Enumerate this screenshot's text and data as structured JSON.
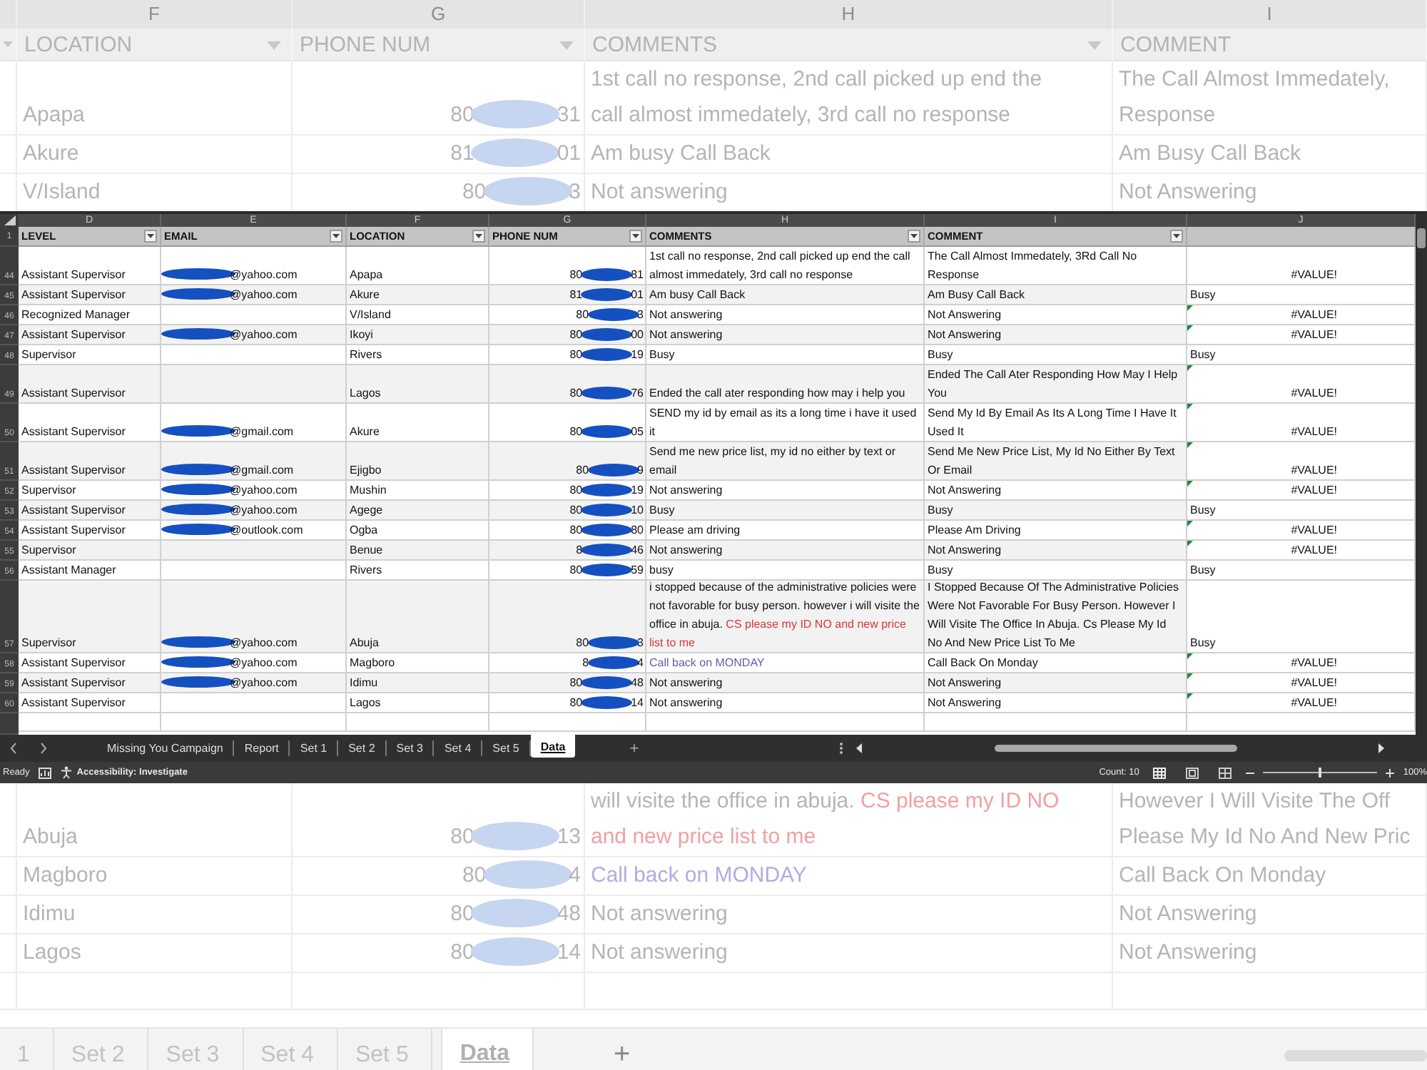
{
  "background_top": {
    "column_letters": [
      "F",
      "G",
      "H",
      "I"
    ],
    "headers": [
      "LOCATION",
      "PHONE NUM",
      "COMMENTS",
      "COMMENT"
    ],
    "rows": [
      {
        "location": "Apapa",
        "phone_start": "80",
        "phone_end": "31",
        "comments": [
          [
            {
              "text": "1st call no response, 2nd call picked up end the"
            }
          ],
          [
            {
              "text": "call almost immedately, 3rd call no response"
            }
          ]
        ],
        "comment": [
          "The Call Almost Immedately,",
          "Response"
        ]
      },
      {
        "location": "Akure",
        "phone_start": "81",
        "phone_end": "01",
        "comments": [
          [
            {
              "text": "Am busy Call Back"
            }
          ]
        ],
        "comment": [
          "Am Busy Call Back"
        ]
      },
      {
        "location": "V/Island",
        "phone_start": "80",
        "phone_end": "3",
        "comments": [
          [
            {
              "text": "Not answering"
            }
          ]
        ],
        "comment": [
          "Not Answering"
        ]
      }
    ]
  },
  "sheet": {
    "column_letters": [
      "D",
      "E",
      "F",
      "G",
      "H",
      "I",
      "J"
    ],
    "header_row_number": "1",
    "headers": [
      "LEVEL",
      "EMAIL",
      "LOCATION",
      "PHONE NUM",
      "COMMENTS",
      "COMMENT"
    ],
    "rows": [
      {
        "num": "44",
        "level": "Assistant Supervisor",
        "email": "@yahoo.com",
        "location": "Apapa",
        "phone_start": "80",
        "phone_end": "81",
        "comments": [
          {
            "text": "1st call no response, 2nd call picked up end the call almost immedately, 3rd call no response"
          }
        ],
        "comment": "The Call Almost Immedately, 3Rd Call No Response",
        "col_j": {
          "text": "#VALUE!",
          "kind": "error",
          "flag": false
        }
      },
      {
        "num": "45",
        "level": "Assistant Supervisor",
        "email": "@yahoo.com",
        "location": "Akure",
        "phone_start": "81",
        "phone_end": "01",
        "comments": [
          {
            "text": "Am busy Call Back"
          }
        ],
        "comment": "Am Busy Call Back",
        "col_j": {
          "text": "Busy",
          "kind": "text",
          "flag": false
        }
      },
      {
        "num": "46",
        "level": "Recognized Manager",
        "location": "V/Island",
        "phone_start": "80",
        "phone_end": "3",
        "comments": [
          {
            "text": "Not answering"
          }
        ],
        "comment": "Not Answering",
        "col_j": {
          "text": "#VALUE!",
          "kind": "error",
          "flag": true
        }
      },
      {
        "num": "47",
        "level": "Assistant Supervisor",
        "email": "@yahoo.com",
        "location": "Ikoyi",
        "phone_start": "80",
        "phone_end": "00",
        "comments": [
          {
            "text": "Not answering"
          }
        ],
        "comment": "Not Answering",
        "col_j": {
          "text": "#VALUE!",
          "kind": "error",
          "flag": true
        }
      },
      {
        "num": "48",
        "level": "Supervisor",
        "location": "Rivers",
        "phone_start": "80",
        "phone_end": "19",
        "comments": [
          {
            "text": "Busy"
          }
        ],
        "comment": "Busy",
        "col_j": {
          "text": "Busy",
          "kind": "text",
          "flag": false
        }
      },
      {
        "num": "49",
        "level": "Assistant Supervisor",
        "location": "Lagos",
        "phone_start": "80",
        "phone_end": "76",
        "comments": [
          {
            "text": "Ended the call ater responding how may i help you"
          }
        ],
        "comment": "Ended The Call Ater Responding How May I Help You",
        "col_j": {
          "text": "#VALUE!",
          "kind": "error",
          "flag": true
        }
      },
      {
        "num": "50",
        "level": "Assistant Supervisor",
        "email": "@gmail.com",
        "location": "Akure",
        "phone_start": "80",
        "phone_end": "05",
        "comments": [
          {
            "text": "SEND my id by email as its a long time i have it used it"
          }
        ],
        "comment": "Send My Id By Email As Its A Long Time I Have It Used It",
        "col_j": {
          "text": "#VALUE!",
          "kind": "error",
          "flag": true
        }
      },
      {
        "num": "51",
        "level": "Assistant Supervisor",
        "email": "@gmail.com",
        "location": "Ejigbo",
        "phone_start": "80",
        "phone_end": "9",
        "comments": [
          {
            "text": "Send me new price list, my id no either by text or email"
          }
        ],
        "comment": "Send Me New Price List, My Id No Either By Text Or Email",
        "col_j": {
          "text": "#VALUE!",
          "kind": "error",
          "flag": true
        }
      },
      {
        "num": "52",
        "level": "Supervisor",
        "email": "@yahoo.com",
        "location": "Mushin",
        "phone_start": "80",
        "phone_end": "19",
        "comments": [
          {
            "text": "Not answering"
          }
        ],
        "comment": "Not Answering",
        "col_j": {
          "text": "#VALUE!",
          "kind": "error",
          "flag": true
        }
      },
      {
        "num": "53",
        "level": "Assistant Supervisor",
        "email": "@yahoo.com",
        "location": "Agege",
        "phone_start": "80",
        "phone_end": "10",
        "comments": [
          {
            "text": "Busy"
          }
        ],
        "comment": "Busy",
        "col_j": {
          "text": "Busy",
          "kind": "text",
          "flag": false
        }
      },
      {
        "num": "54",
        "level": "Assistant Supervisor",
        "email": "@outlook.com",
        "location": "Ogba",
        "phone_start": "80",
        "phone_end": "80",
        "comments": [
          {
            "text": "Please am driving"
          }
        ],
        "comment": "Please Am Driving",
        "col_j": {
          "text": "#VALUE!",
          "kind": "error",
          "flag": true
        }
      },
      {
        "num": "55",
        "level": "Supervisor",
        "location": "Benue",
        "phone_start": "8",
        "phone_end": "46",
        "comments": [
          {
            "text": "Not answering"
          }
        ],
        "comment": "Not Answering",
        "col_j": {
          "text": "#VALUE!",
          "kind": "error",
          "flag": true
        }
      },
      {
        "num": "56",
        "level": "Assistant Manager",
        "location": "Rivers",
        "phone_start": "80",
        "phone_end": "59",
        "comments": [
          {
            "text": "busy"
          }
        ],
        "comment": "Busy",
        "col_j": {
          "text": "Busy",
          "kind": "text",
          "flag": false
        }
      },
      {
        "num": "57",
        "level": "Supervisor",
        "email": "@yahoo.com",
        "location": "Abuja",
        "phone_start": "80",
        "phone_end": "3",
        "comments": [
          {
            "text": "i stopped because of the administrative policies were not favorable for busy person. however i will visite the office in abuja. "
          },
          {
            "text": "CS please my ID NO and new price list to me",
            "color": "#d9343a"
          }
        ],
        "comment": "I Stopped Because Of The Administrative Policies Were Not Favorable For Busy Person. However I Will Visite The Office In Abuja. Cs Please My Id No And New Price List To Me",
        "col_j": {
          "text": "Busy",
          "kind": "text",
          "flag": false
        }
      },
      {
        "num": "58",
        "level": "Assistant Supervisor",
        "email": "@yahoo.com",
        "location": "Magboro",
        "phone_start": "8",
        "phone_end": "4",
        "comments": [
          {
            "text": "Call back on MONDAY",
            "color": "#6a5aa8"
          }
        ],
        "comment": "Call Back On Monday",
        "col_j": {
          "text": "#VALUE!",
          "kind": "error",
          "flag": true
        }
      },
      {
        "num": "59",
        "level": "Assistant Supervisor",
        "email": "@yahoo.com",
        "location": "Idimu",
        "phone_start": "80",
        "phone_end": "48",
        "comments": [
          {
            "text": "Not answering"
          }
        ],
        "comment": "Not Answering",
        "col_j": {
          "text": "#VALUE!",
          "kind": "error",
          "flag": true
        }
      },
      {
        "num": "60",
        "level": "Assistant Supervisor",
        "location": "Lagos",
        "phone_start": "80",
        "phone_end": "14",
        "comments": [
          {
            "text": "Not answering"
          }
        ],
        "comment": "Not Answering",
        "col_j": {
          "text": "#VALUE!",
          "kind": "error",
          "flag": true
        }
      }
    ],
    "tabs": [
      {
        "label": "Missing You Campaign",
        "selected": false
      },
      {
        "label": "Report",
        "selected": false
      },
      {
        "label": "Set 1",
        "selected": false
      },
      {
        "label": "Set 2",
        "selected": false
      },
      {
        "label": "Set 3",
        "selected": false
      },
      {
        "label": "Set 4",
        "selected": false
      },
      {
        "label": "Set 5",
        "selected": false
      },
      {
        "label": "Data",
        "selected": true
      }
    ],
    "add_sheet": "+",
    "status_bar": {
      "ready": "Ready",
      "accessibility": "Accessibility: Investigate",
      "count": "Count: 10",
      "zoom_slider": {
        "level": 0.5
      },
      "zoom": "100%"
    }
  },
  "background_bottom": {
    "rows": [
      {
        "location": "Abuja",
        "phone_start": "80",
        "phone_end": "13",
        "comments": [
          [
            {
              "text": "will visite the office in abuja. "
            },
            {
              "text": "CS please my ID NO",
              "color": "#f2a0a3"
            }
          ],
          [
            {
              "text": "and new price list to me",
              "color": "#f2a0a3"
            }
          ]
        ],
        "comment": [
          "However I Will Visite The Off",
          "Please My Id No And New Pric"
        ]
      },
      {
        "location": "Magboro",
        "phone_start": "80",
        "phone_end": "4",
        "comments": [
          [
            {
              "text": "Call back on MONDAY",
              "color": "#b4abe0"
            }
          ]
        ],
        "comment": [
          "Call Back On Monday"
        ]
      },
      {
        "location": "Idimu",
        "phone_start": "80",
        "phone_end": "48",
        "comments": [
          [
            {
              "text": "Not answering"
            }
          ]
        ],
        "comment": [
          "Not Answering"
        ]
      },
      {
        "location": "Lagos",
        "phone_start": "80",
        "phone_end": "14",
        "comments": [
          [
            {
              "text": "Not answering"
            }
          ]
        ],
        "comment": [
          "Not Answering"
        ]
      }
    ],
    "tabs": [
      {
        "label": "1",
        "selected": false
      },
      {
        "label": "Set 2",
        "selected": false
      },
      {
        "label": "Set 3",
        "selected": false
      },
      {
        "label": "Set 4",
        "selected": false
      },
      {
        "label": "Set 5",
        "selected": false
      },
      {
        "label": "Data",
        "selected": true
      }
    ],
    "add_sheet": "+"
  }
}
